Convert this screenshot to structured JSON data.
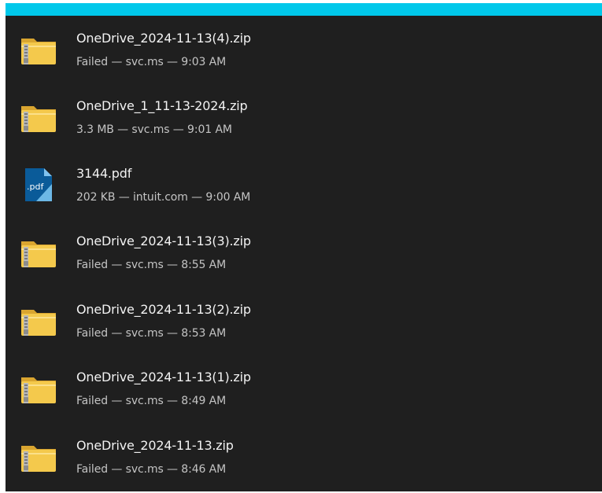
{
  "colors": {
    "accent": "#00c8ea",
    "background": "#1f1f1f",
    "title_text": "#f2f2f2",
    "meta_text": "#c4c4c4",
    "zip_folder": "#f4c94c",
    "pdf_icon": "#0a5b99"
  },
  "downloads": {
    "items": [
      {
        "icon": "zip-folder-icon",
        "name": "OneDrive_2024-11-13(4).zip",
        "meta": "Failed — svc.ms — 9:03 AM"
      },
      {
        "icon": "zip-folder-icon",
        "name": "OneDrive_1_11-13-2024.zip",
        "meta": "3.3 MB — svc.ms — 9:01 AM"
      },
      {
        "icon": "pdf-file-icon",
        "name": "3144.pdf",
        "meta": "202 KB — intuit.com — 9:00 AM",
        "icon_label": ".pdf"
      },
      {
        "icon": "zip-folder-icon",
        "name": "OneDrive_2024-11-13(3).zip",
        "meta": "Failed — svc.ms — 8:55 AM"
      },
      {
        "icon": "zip-folder-icon",
        "name": "OneDrive_2024-11-13(2).zip",
        "meta": "Failed — svc.ms — 8:53 AM"
      },
      {
        "icon": "zip-folder-icon",
        "name": "OneDrive_2024-11-13(1).zip",
        "meta": "Failed — svc.ms — 8:49 AM"
      },
      {
        "icon": "zip-folder-icon",
        "name": "OneDrive_2024-11-13.zip",
        "meta": "Failed — svc.ms — 8:46 AM"
      }
    ]
  }
}
